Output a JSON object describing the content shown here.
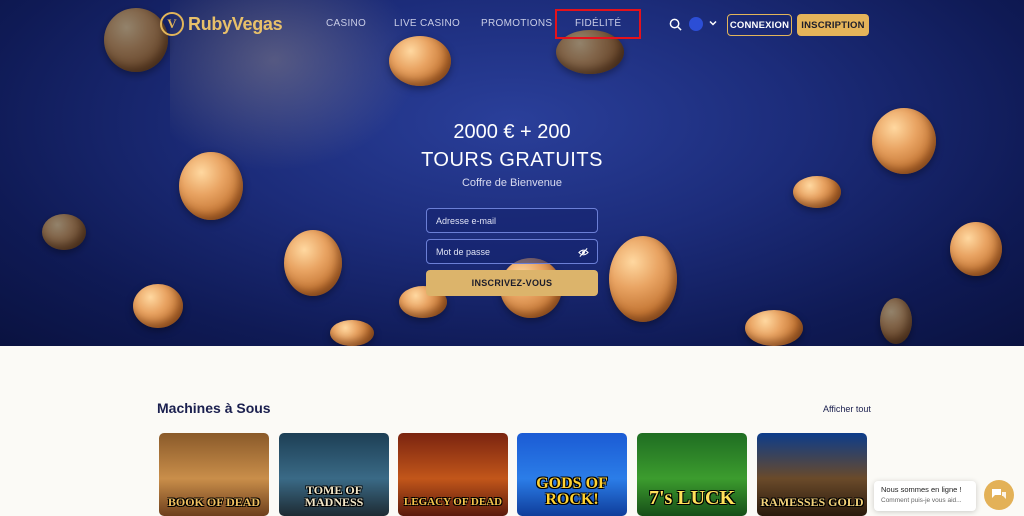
{
  "nav": {
    "logo_mark": "V",
    "logo_text": "RubyVegas",
    "links": [
      "CASINO",
      "LIVE CASINO",
      "PROMOTIONS",
      "FIDÉLITÉ"
    ],
    "login_label": "CONNEXION",
    "signup_label": "INSCRIPTION"
  },
  "hero": {
    "title_line1": "2000 € + 200",
    "title_line2": "TOURS GRATUITS",
    "subtitle": "Coffre de Bienvenue",
    "email_placeholder": "Adresse e-mail",
    "password_placeholder": "Mot de passe",
    "cta_label": "INSCRIVEZ-VOUS"
  },
  "section": {
    "title": "Machines à Sous",
    "see_all": "Afficher tout",
    "games": [
      {
        "title": "BOOK OF DEAD"
      },
      {
        "title": "TOME OF MADNESS"
      },
      {
        "title": "LEGACY OF DEAD"
      },
      {
        "title": "GODS OF ROCK!"
      },
      {
        "title": "7's LUCK"
      },
      {
        "title": "RAMESSES GOLD"
      }
    ]
  },
  "chat": {
    "title": "Nous sommes en ligne !",
    "subtitle": "Comment puis-je vous aid..."
  }
}
